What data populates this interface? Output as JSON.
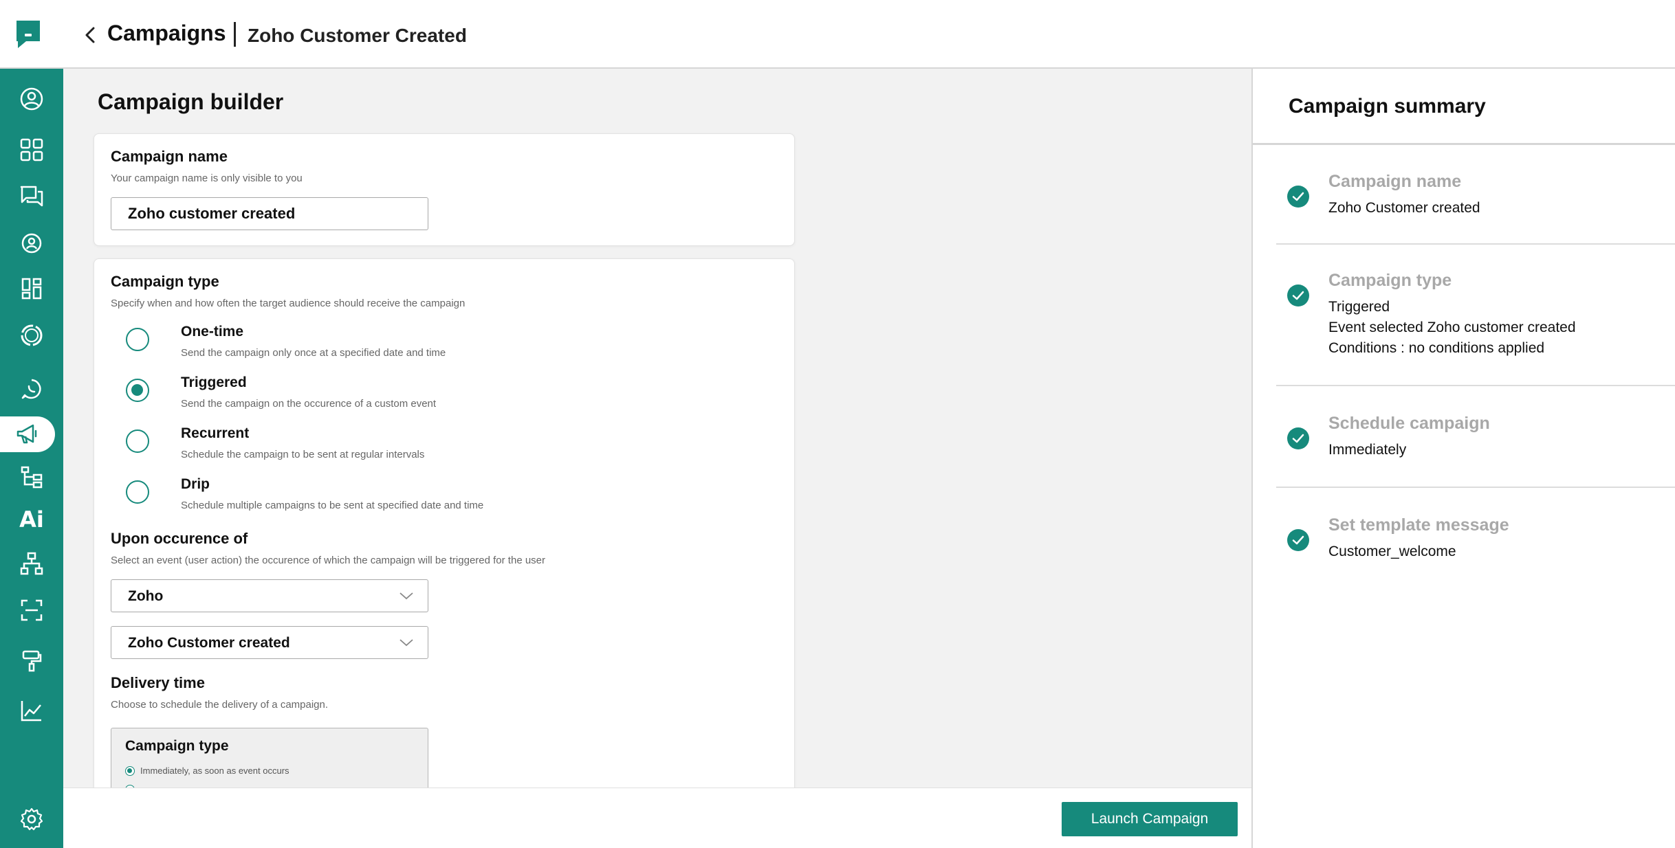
{
  "header": {
    "back_title": "Campaigns",
    "campaign_title": "Zoho Customer Created"
  },
  "sidebar": {
    "items": [
      {
        "icon": "user-circle-icon"
      },
      {
        "icon": "grid-icon"
      },
      {
        "icon": "chat-icon"
      },
      {
        "icon": "contact-icon"
      },
      {
        "icon": "dashboard-icon"
      },
      {
        "icon": "refresh-icon"
      },
      {
        "icon": "whatsapp-icon"
      },
      {
        "icon": "megaphone-icon",
        "active": true
      },
      {
        "icon": "flow-icon"
      },
      {
        "icon": "ai-icon",
        "label": "Ai"
      },
      {
        "icon": "org-chart-icon"
      },
      {
        "icon": "scan-icon"
      },
      {
        "icon": "paint-roller-icon"
      },
      {
        "icon": "line-chart-icon"
      },
      {
        "icon": "gear-icon"
      }
    ]
  },
  "builder": {
    "title": "Campaign builder",
    "name_section": {
      "title": "Campaign name",
      "subtitle": "Your campaign name is only visible to you",
      "value": "Zoho customer created"
    },
    "type_section": {
      "title": "Campaign type",
      "subtitle": "Specify when and how often the target audience should receive the campaign",
      "options": [
        {
          "label": "One-time",
          "description": "Send the campaign only once at a specified date and time",
          "selected": false
        },
        {
          "label": "Triggered",
          "description": "Send the campaign on the occurence of a custom event",
          "selected": true
        },
        {
          "label": "Recurrent",
          "description": "Schedule the campaign to be sent at regular intervals",
          "selected": false
        },
        {
          "label": "Drip",
          "description": "Schedule multiple campaigns to be sent at specified date and time",
          "selected": false
        }
      ]
    },
    "occurence_section": {
      "title": "Upon occurence of",
      "subtitle": "Select an event (user action) the occurence of which the campaign will be triggered for the user",
      "source_value": "Zoho",
      "event_value": "Zoho Customer created"
    },
    "delivery_section": {
      "title": "Delivery time",
      "subtitle": "Choose to schedule the delivery of a campaign.",
      "box_title": "Campaign type",
      "option_immediate": "Immediately, as soon as event occurs"
    }
  },
  "footer": {
    "launch_label": "Launch Campaign"
  },
  "summary": {
    "title": "Campaign summary",
    "items": [
      {
        "label": "Campaign name",
        "values": [
          "Zoho Customer created"
        ]
      },
      {
        "label": "Campaign type",
        "values": [
          "Triggered",
          "Event selected Zoho customer created",
          "Conditions : no conditions applied"
        ]
      },
      {
        "label": "Schedule campaign",
        "values": [
          "Immediately"
        ]
      },
      {
        "label": "Set template message",
        "values": [
          "Customer_welcome"
        ]
      }
    ]
  },
  "colors": {
    "brand": "#168a7c",
    "sidebar": "#168a7c",
    "muted_label": "#a8a8a8"
  }
}
